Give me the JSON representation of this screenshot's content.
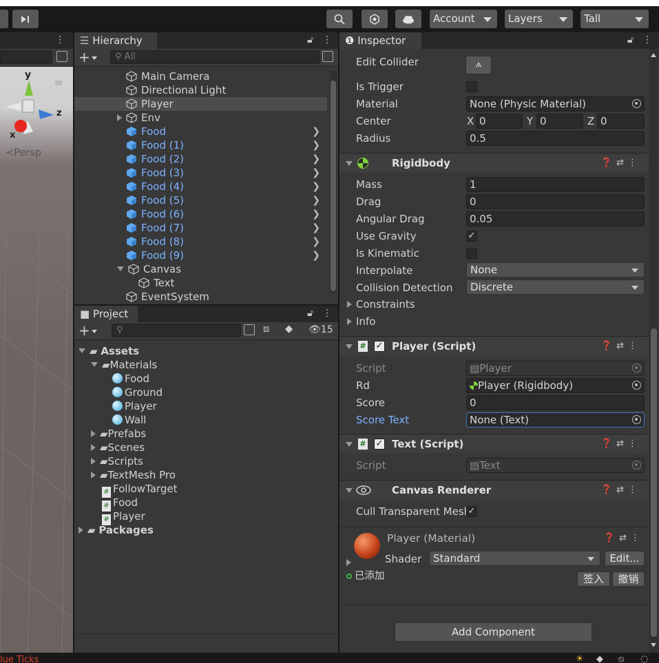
{
  "toolbar": {
    "account": "Account",
    "layers": "Layers",
    "layout": "Tall"
  },
  "scene": {
    "persp_label": "≺Persp",
    "axis_y": "y",
    "axis_x": "x",
    "axis_z": "z",
    "status_text": "lue Ticks"
  },
  "hierarchy": {
    "tab": "Hierarchy",
    "search_placeholder": "All",
    "items": [
      {
        "label": "Main Camera"
      },
      {
        "label": "Directional Light"
      },
      {
        "label": "Player"
      },
      {
        "label": "Env"
      },
      {
        "label": "Food"
      },
      {
        "label": "Food (1)"
      },
      {
        "label": "Food (2)"
      },
      {
        "label": "Food (3)"
      },
      {
        "label": "Food (4)"
      },
      {
        "label": "Food (5)"
      },
      {
        "label": "Food (6)"
      },
      {
        "label": "Food (7)"
      },
      {
        "label": "Food (8)"
      },
      {
        "label": "Food (9)"
      },
      {
        "label": "Canvas"
      },
      {
        "label": "Text"
      },
      {
        "label": "EventSystem"
      }
    ]
  },
  "project": {
    "tab": "Project",
    "hidden_count": "15",
    "items": [
      {
        "label": "Assets"
      },
      {
        "label": "Materials"
      },
      {
        "label": "Food"
      },
      {
        "label": "Ground"
      },
      {
        "label": "Player"
      },
      {
        "label": "Wall"
      },
      {
        "label": "Prefabs"
      },
      {
        "label": "Scenes"
      },
      {
        "label": "Scripts"
      },
      {
        "label": "TextMesh Pro"
      },
      {
        "label": "FollowTarget"
      },
      {
        "label": "Food"
      },
      {
        "label": "Player"
      },
      {
        "label": "Packages"
      }
    ]
  },
  "inspector": {
    "tab": "Inspector",
    "collider": {
      "edit": "Edit Collider",
      "is_trigger": "Is Trigger",
      "material": "Material",
      "material_value": "None (Physic Material)",
      "center": "Center",
      "cx_label": "X",
      "cx": "0",
      "cy_label": "Y",
      "cy": "0",
      "cz_label": "Z",
      "cz": "0",
      "radius": "Radius",
      "radius_value": "0.5"
    },
    "rigidbody": {
      "title": "Rigidbody",
      "mass": "Mass",
      "mass_value": "1",
      "drag": "Drag",
      "drag_value": "0",
      "angular_drag": "Angular Drag",
      "angular_drag_value": "0.05",
      "use_gravity": "Use Gravity",
      "is_kinematic": "Is Kinematic",
      "interpolate": "Interpolate",
      "interpolate_value": "None",
      "collision": "Collision Detection",
      "collision_value": "Discrete",
      "constraints": "Constraints",
      "info": "Info"
    },
    "player_script": {
      "title": "Player (Script)",
      "script": "Script",
      "script_value": "Player",
      "rd": "Rd",
      "rd_value": "Player (Rigidbody)",
      "score": "Score",
      "score_value": "0",
      "score_text": "Score Text",
      "score_text_value": "None (Text)"
    },
    "text_script": {
      "title": "Text (Script)",
      "script": "Script",
      "script_value": "Text"
    },
    "canvas_renderer": {
      "title": "Canvas Renderer",
      "cull": "Cull Transparent Mesh"
    },
    "material": {
      "title": "Player (Material)",
      "shader": "Shader",
      "shader_value": "Standard",
      "edit": "Edit...",
      "added": "已添加",
      "checkin": "签入",
      "revert": "撤销"
    },
    "add_component": "Add Component"
  },
  "colors": {
    "accent_blue": "#7cb2ff",
    "panel": "#383838",
    "toolbar": "#191919"
  }
}
